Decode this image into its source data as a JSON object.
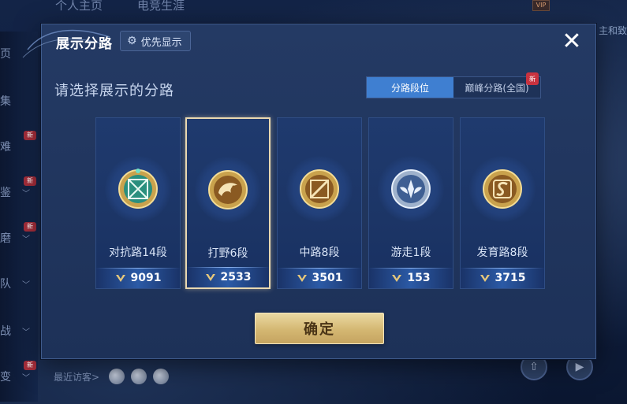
{
  "background": {
    "tabs": [
      "个人主页",
      "电竞生涯"
    ],
    "side_items": [
      {
        "label": "页",
        "chevron": false,
        "new": false
      },
      {
        "label": "集",
        "chevron": false,
        "new": false
      },
      {
        "label": "难",
        "chevron": false,
        "new": true
      },
      {
        "label": "鉴",
        "chevron": true,
        "new": true
      },
      {
        "label": "磨",
        "chevron": true,
        "new": true
      },
      {
        "label": "队",
        "chevron": true,
        "new": false
      },
      {
        "label": "战",
        "chevron": true,
        "new": false
      },
      {
        "label": "变",
        "chevron": true,
        "new": true
      }
    ],
    "new_tag": "新",
    "vip_label": "VIP",
    "right_text": "主和致",
    "recent_visitors_label": "最近访客>"
  },
  "modal": {
    "title": "展示分路",
    "priority_label": "优先显示",
    "close_symbol": "✕",
    "subtitle": "请选择展示的分路",
    "tabs": {
      "active": "分路段位",
      "inactive": "巅峰分路(全国)",
      "new_badge": "新"
    },
    "confirm_label": "确定"
  },
  "lanes": [
    {
      "name": "对抗路14段",
      "score": "9091",
      "emblem": "clash-lane-emblem",
      "selected": false
    },
    {
      "name": "打野6段",
      "score": "2533",
      "emblem": "jungle-emblem",
      "selected": true
    },
    {
      "name": "中路8段",
      "score": "3501",
      "emblem": "mid-lane-emblem",
      "selected": false
    },
    {
      "name": "游走1段",
      "score": "153",
      "emblem": "roam-emblem",
      "selected": false
    },
    {
      "name": "发育路8段",
      "score": "3715",
      "emblem": "farm-lane-emblem",
      "selected": false
    }
  ],
  "colors": {
    "accent_blue": "#3f7fd1",
    "gold": "#d4b772",
    "selected_border": "#e9d8b0",
    "badge_red": "#c9323f"
  }
}
